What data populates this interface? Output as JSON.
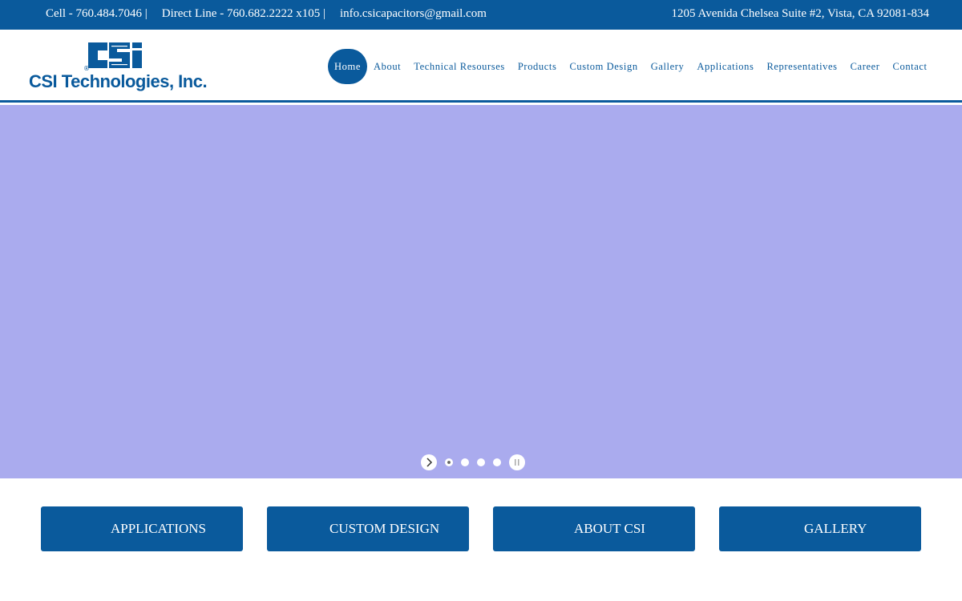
{
  "topbar": {
    "cell": "Cell - 760.484.7046 |",
    "direct": "Direct Line - 760.682.2222 x105 |",
    "email": "info.csicapacitors@gmail.com",
    "address": "1205 Avenida Chelsea Suite #2, Vista, CA 92081-834"
  },
  "header": {
    "logo_mark": "CSi",
    "logo_registered": "®",
    "company_name": "CSI Technologies, Inc.",
    "nav": [
      {
        "label": "Home",
        "active": true
      },
      {
        "label": "About"
      },
      {
        "label": "Technical Resourses"
      },
      {
        "label": "Products"
      },
      {
        "label": "Custom Design"
      },
      {
        "label": "Gallery"
      },
      {
        "label": "Applications"
      },
      {
        "label": "Representatives"
      },
      {
        "label": "Career"
      },
      {
        "label": "Contact"
      }
    ]
  },
  "hero": {
    "background_color": "#aaabee",
    "slide_count": 4,
    "active_slide": 1
  },
  "cta": [
    {
      "label": "APPLICATIONS"
    },
    {
      "label": "CUSTOM DESIGN"
    },
    {
      "label": "ABOUT CSI"
    },
    {
      "label": "GALLERY"
    }
  ],
  "colors": {
    "brand_blue": "#0a5a9c",
    "white": "#ffffff"
  },
  "icons": {
    "next": "chevron-right-icon",
    "pause": "pause-icon"
  }
}
